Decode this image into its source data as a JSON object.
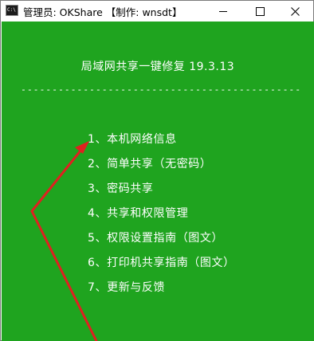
{
  "window": {
    "title": "管理员:  OKShare 【制作: wnsdt】",
    "app_icon_text": "C:\\",
    "controls": [
      "minimize",
      "maximize",
      "close"
    ]
  },
  "console": {
    "heading": "局域网共享一键修复 19.3.13",
    "separator": "------------------------------------------------------",
    "menu": [
      "1、本机网络信息",
      "2、简单共享（无密码）",
      "3、密码共享",
      "4、共享和权限管理",
      "5、权限设置指南（图文）",
      "6、打印机共享指南（图文）",
      "7、更新与反馈"
    ],
    "background_color": "#1fa41f",
    "text_color": "#ffffff"
  },
  "annotation": {
    "arrow_color": "#e02020"
  }
}
